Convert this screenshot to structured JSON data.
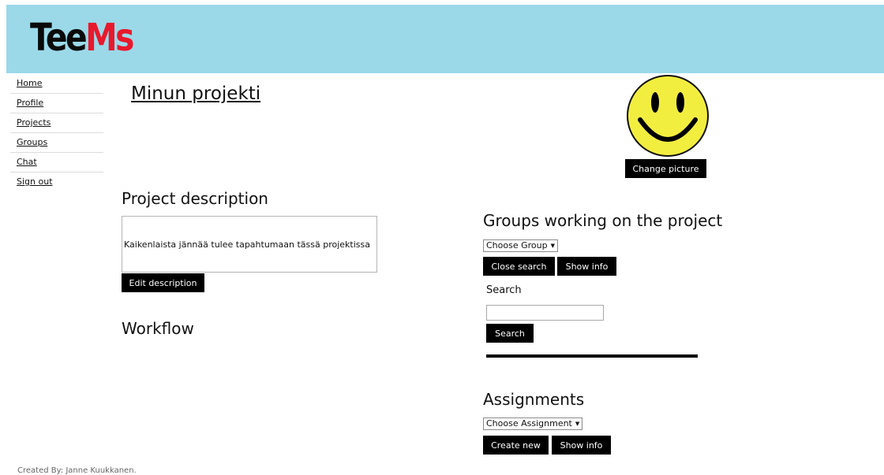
{
  "header": {
    "logo_part1": "Tee",
    "logo_part2": "Ms"
  },
  "nav": {
    "items": [
      "Home",
      "Profile",
      "Projects",
      "Groups",
      "Chat",
      "Sign out"
    ]
  },
  "project": {
    "title": "Minun projekti",
    "change_picture_label": "Change picture"
  },
  "description": {
    "heading": "Project description",
    "text": "Kaikenlaista jännää tulee tapahtumaan tässä projektissa",
    "edit_label": "Edit description"
  },
  "workflow": {
    "heading": "Workflow"
  },
  "groups": {
    "heading": "Groups working on the project",
    "select_value": "Choose Group",
    "close_search_label": "Close search",
    "show_info_label": "Show info",
    "search_label": "Search",
    "search_value": "",
    "search_button_label": "Search"
  },
  "assignments": {
    "heading": "Assignments",
    "select_value": "Choose Assignment",
    "create_new_label": "Create new",
    "show_info_label": "Show info"
  },
  "footer": {
    "text": "Created By: Janne Kuukkanen."
  },
  "colors": {
    "header_bg": "#9bd9e9",
    "logo_red": "#e8192c",
    "button_bg": "#000000",
    "smiley_yellow": "#f2ee3f"
  }
}
